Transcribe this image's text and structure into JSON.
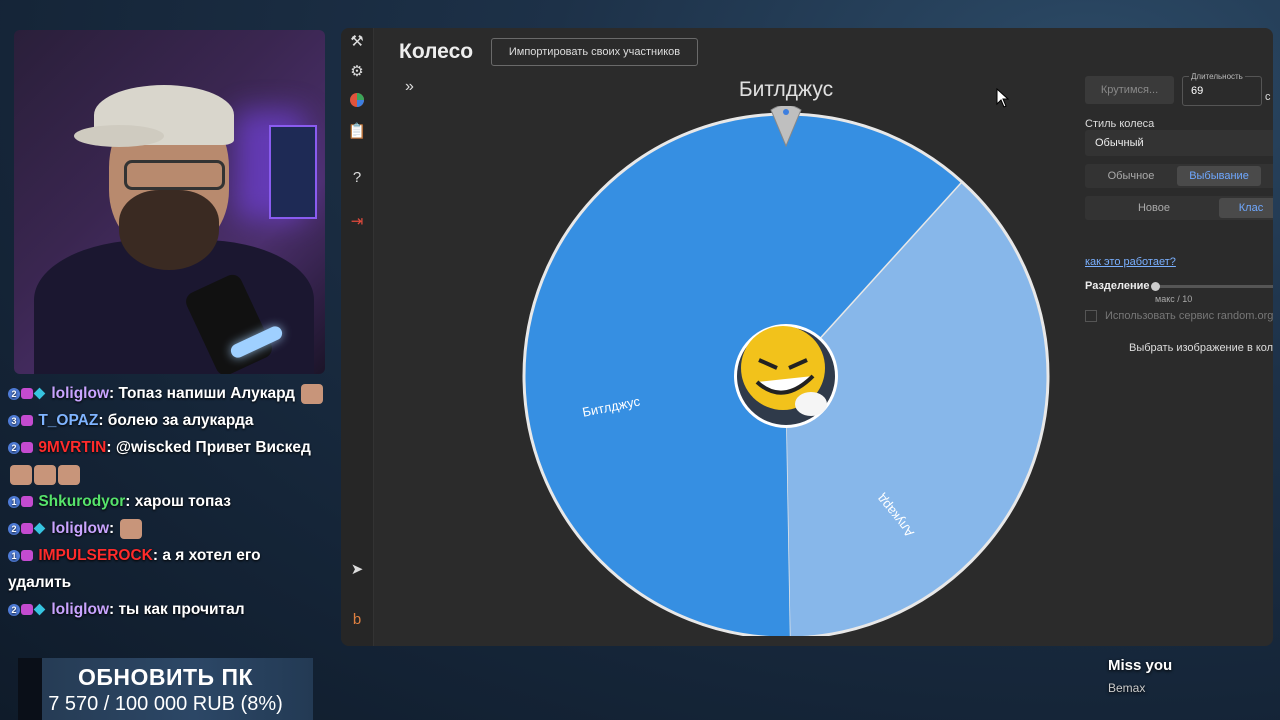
{
  "chat": {
    "messages": [
      {
        "badge": "2",
        "user": "loliglow",
        "text": "Топаз напиши Алукард",
        "user_color": "#c9a4ff"
      },
      {
        "badge": "3",
        "user": "T_OPAZ",
        "text": "болею за алукарда",
        "user_color": "#7fb4ff"
      },
      {
        "badge": "2",
        "user": "9MVRTIN",
        "text": "@wiscked Привет Вискед",
        "user_color": "#ff2b2b"
      },
      {
        "badge": "1",
        "user": "Shkurodyor",
        "text": "харош топаз",
        "user_color": "#56e36b"
      },
      {
        "badge": "2",
        "user": "loliglow",
        "text": "",
        "user_color": "#c9a4ff"
      },
      {
        "badge": "1",
        "user": "IMPULSEROCK",
        "text": "а я хотел его удалить",
        "user_color": "#ff2b2b"
      },
      {
        "badge": "2",
        "user": "loliglow",
        "text": "ты как прочитал",
        "user_color": "#c9a4ff"
      }
    ]
  },
  "goal": {
    "title": "ОБНОВИТЬ ПК",
    "progress_text": "7 570 / 100 000 RUB (8%)",
    "progress": 0.08
  },
  "app": {
    "title": "Колесо",
    "import_label": "Импортировать своих участников",
    "expand_icon": "»",
    "winner": "Битлджус",
    "wheel": {
      "segments": [
        {
          "label": "Битлджус",
          "fraction": 0.62,
          "color": "#368fe2"
        },
        {
          "label": "Алукард",
          "fraction": 0.38,
          "color": "#87b7ea"
        }
      ],
      "start_angle_deg": 89
    },
    "panel": {
      "spin_label": "Крутимся...",
      "duration_label": "Длительность",
      "duration_value": "69",
      "duration_unit": "с",
      "style_label": "Стиль колеса",
      "style_value": "Обычный",
      "mode_options": [
        "Обычное",
        "Выбывание"
      ],
      "mode_active": "Выбывание",
      "type_options": [
        "Новое",
        "Клас"
      ],
      "type_active": "Клас",
      "how_link": "как это работает?",
      "split_label": "Разделение",
      "split_max": "макс / 10",
      "random_org": "Использовать сервис random.org",
      "pick_image": "Выбрать изображение в кол"
    }
  },
  "overlay": {
    "miss_title": "Miss you",
    "miss_sub": "Bemax"
  }
}
